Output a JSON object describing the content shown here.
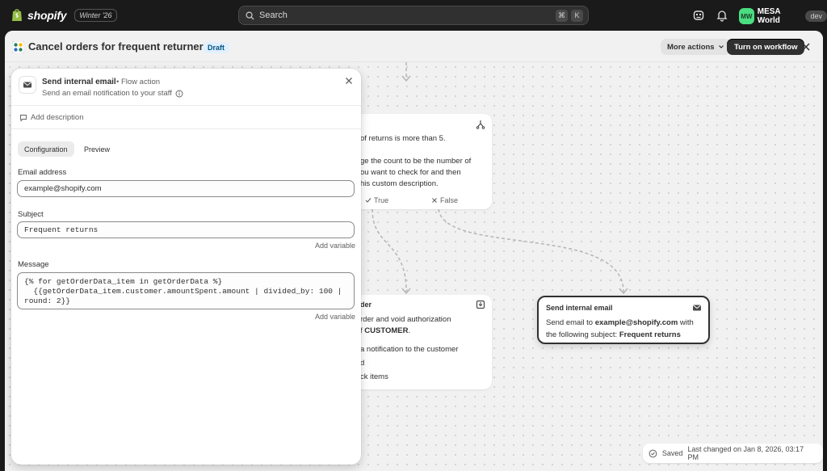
{
  "topbar": {
    "brand": "shopify",
    "edition": "Winter '26",
    "search_placeholder": "Search",
    "shortcut_keys": [
      "⌘",
      "K"
    ],
    "avatar_initials": "MW",
    "store_name": "MESA World",
    "env_badge": "dev"
  },
  "header": {
    "title": "Cancel orders for frequent returners",
    "status": "Draft",
    "more_actions": "More actions",
    "primary_action": "Turn on workflow"
  },
  "canvas": {
    "condition_node": {
      "lines": [
        "of returns is more than 5.",
        "ge the count to be the number of",
        "ou want to check for and then",
        "his custom description."
      ],
      "true_label": "True",
      "false_label": "False"
    },
    "cancel_node": {
      "title_fragment": "der",
      "line1": "rder and void authorization",
      "line2_prefix": "f ",
      "line2_bold": "CUSTOMER",
      "line2_suffix": ".",
      "line3": "a notification to the customer",
      "line4": "d",
      "line5": "ck items"
    },
    "email_node": {
      "title": "Send internal email",
      "body_prefix": "Send email to ",
      "body_email": "example@shopify.com",
      "body_mid": " with the following subject: ",
      "body_subject": "Frequent returns"
    },
    "saved": {
      "label": "Saved",
      "changed": "Last changed on Jan 8, 2026, 03:17 PM"
    }
  },
  "panel": {
    "title": "Send internal email",
    "type": "Flow action",
    "subtitle": "Send an email notification to your staff",
    "add_description": "Add description",
    "tabs": [
      "Configuration",
      "Preview"
    ],
    "email_label": "Email address",
    "email_value": "example@shopify.com",
    "subject_label": "Subject",
    "subject_value": "Frequent returns",
    "add_variable": "Add variable",
    "message_label": "Message",
    "message_value": "{% for getOrderData_item in getOrderData %}\n  {{getOrderData_item.customer.amountSpent.amount | divided_by: 100 |\nround: 2}}"
  }
}
